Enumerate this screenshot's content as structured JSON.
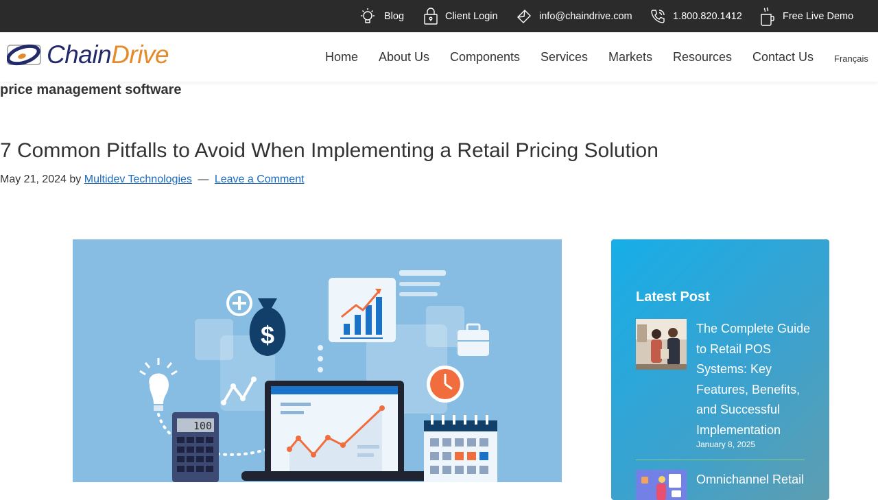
{
  "topbar": {
    "blog": "Blog",
    "client_login": "Client Login",
    "email": "info@chaindrive.com",
    "phone": "1.800.820.1412",
    "demo": "Free Live Demo"
  },
  "logo": {
    "chain": "Chain",
    "drive": "Drive"
  },
  "nav": {
    "home": "Home",
    "about": "About Us",
    "components": "Components",
    "services": "Services",
    "markets": "Markets",
    "resources": "Resources",
    "contact": "Contact Us",
    "language": "Français"
  },
  "archive": {
    "title": "price management software"
  },
  "post": {
    "title": "7 Common Pitfalls to Avoid When Implementing a Retail Pricing Solution",
    "date": "May 21, 2024",
    "by": "by",
    "author": "Multidev Technologies",
    "separator": "—",
    "comment_link": "Leave a Comment"
  },
  "featured": {
    "calculator_display": "100"
  },
  "sidebar": {
    "title": "Latest Post",
    "posts": [
      {
        "title": "The Complete Guide to Retail POS Systems: Key Features, Benefits, and Successful Implementation",
        "date": "January 8, 2025"
      },
      {
        "title": "Omnichannel Retail"
      }
    ]
  },
  "colors": {
    "topbar_bg": "#2b2b2b",
    "brand_navy": "#232a6b",
    "brand_orange": "#e58a2c",
    "link": "#1a6bbf",
    "sidebar_top": "#16aee8",
    "image_bg": "#87bde3"
  },
  "icons": {
    "blog": "lightbulb-icon",
    "login": "lock-icon",
    "email": "envelope-icon",
    "phone": "phone-icon",
    "demo": "coffee-cup-icon"
  }
}
